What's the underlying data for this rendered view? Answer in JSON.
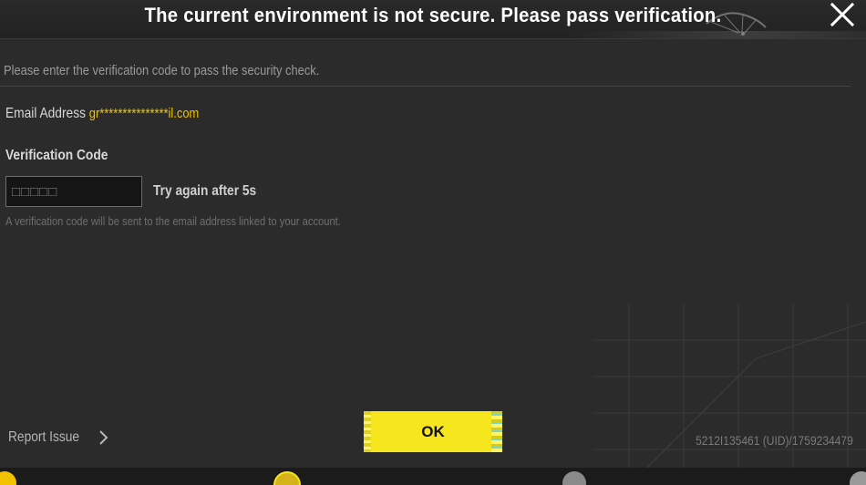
{
  "dialog": {
    "title": "The current environment is not secure. Please pass verification.",
    "close_icon": "close-icon",
    "instruction": "Please enter the verification code to pass the security check.",
    "email_label": "Email Address",
    "email_value": "gr***************il.com",
    "code_label": "Verification Code",
    "code_placeholder": "□□□□□",
    "retry_text": "Try again after 5s",
    "hint": "A verification code will be sent to the email address linked to your account.",
    "report_issue_label": "Report Issue",
    "ok_label": "OK",
    "uid_text": "5212I135461 (UID)/1759234479"
  },
  "colors": {
    "background": "#2b2b2b",
    "accent_yellow": "#f5e61e",
    "email_highlight": "#f2c200",
    "title_text": "#ffffff"
  },
  "bottom_icons": [
    "currency-icon",
    "rank-badge-icon",
    "settings-gear-icon",
    "gear-icon"
  ]
}
